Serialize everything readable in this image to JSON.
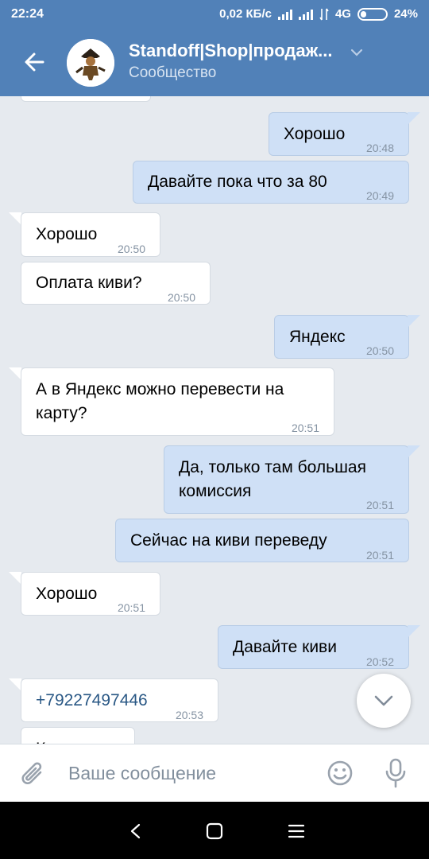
{
  "status_bar": {
    "time": "22:24",
    "net_speed": "0,02 КБ/с",
    "network": "4G",
    "battery": "24%",
    "battery_level": 0.24
  },
  "header": {
    "title": "Standoff|Shop|продаж...",
    "subtitle": "Сообщество",
    "back_icon": "arrow-left-icon",
    "dropdown_icon": "chevron-down-icon"
  },
  "messages": [
    {
      "dir": "out",
      "lines": [
        "Хорошо"
      ],
      "time": "20:48"
    },
    {
      "dir": "out",
      "lines": [
        "Давайте пока что за 80"
      ],
      "time": "20:49"
    },
    {
      "dir": "in",
      "lines": [
        "Хорошо"
      ],
      "time": "20:50"
    },
    {
      "dir": "in",
      "lines": [
        "Оплата киви?"
      ],
      "time": "20:50"
    },
    {
      "dir": "out",
      "lines": [
        "Яндекс"
      ],
      "time": "20:50"
    },
    {
      "dir": "in",
      "lines": [
        "А в Яндекс можно перевести на",
        "карту?"
      ],
      "time": "20:51"
    },
    {
      "dir": "out",
      "lines": [
        "Да, только там большая",
        "комиссия"
      ],
      "time": "20:51"
    },
    {
      "dir": "out",
      "lines": [
        "Сейчас на киви переведу"
      ],
      "time": "20:51"
    },
    {
      "dir": "in",
      "lines": [
        "Хорошо"
      ],
      "time": "20:51"
    },
    {
      "dir": "out",
      "lines": [
        "Давайте киви"
      ],
      "time": "20:52"
    },
    {
      "dir": "in",
      "lines": [
        "+79227497446"
      ],
      "time": "20:53",
      "link": true
    },
    {
      "dir": "in",
      "lines": [
        "К..."
      ],
      "time": ""
    }
  ],
  "composer": {
    "placeholder": "Ваше сообщение",
    "attach_icon": "paperclip-icon",
    "emoji_icon": "smile-icon",
    "mic_icon": "microphone-icon"
  },
  "scroll_button_icon": "chevron-down-icon",
  "colors": {
    "header": "#5181b8",
    "chat_bg": "#e6eaef",
    "outgoing": "#cfe0f6",
    "incoming": "#ffffff",
    "link": "#2a5885"
  }
}
